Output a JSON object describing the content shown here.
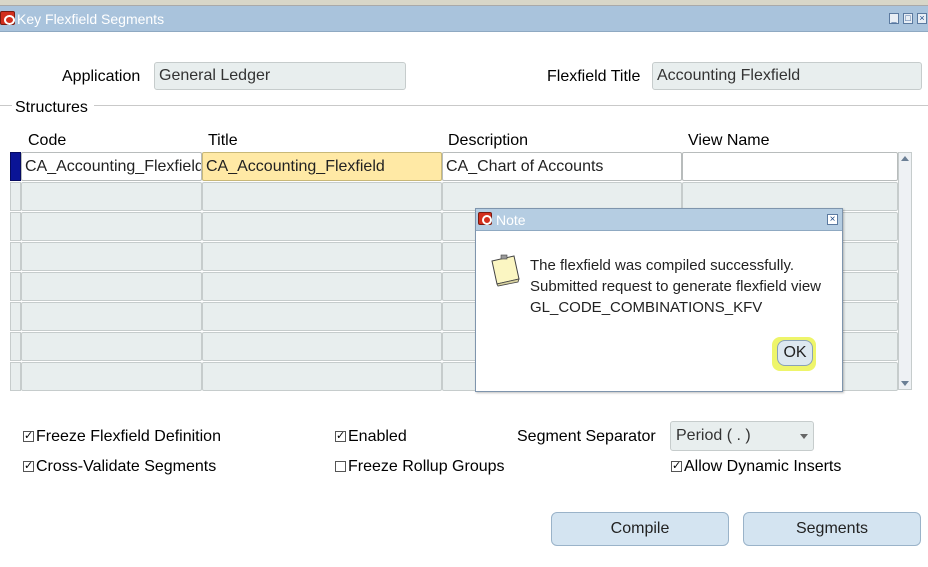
{
  "window": {
    "title": "Key Flexfield Segments"
  },
  "header": {
    "application_label": "Application",
    "application_value": "General Ledger",
    "flexfield_title_label": "Flexfield Title",
    "flexfield_title_value": "Accounting Flexfield"
  },
  "structures": {
    "section_label": "Structures",
    "columns": [
      "Code",
      "Title",
      "Description",
      "View Name"
    ],
    "rows": [
      {
        "code": "CA_Accounting_Flexfield",
        "title": "CA_Accounting_Flexfield",
        "description": "CA_Chart of Accounts",
        "view_name": ""
      }
    ]
  },
  "options": {
    "freeze_definition": {
      "label": "Freeze Flexfield Definition",
      "checked": true
    },
    "cross_validate": {
      "label": "Cross-Validate Segments",
      "checked": true
    },
    "enabled": {
      "label": "Enabled",
      "checked": true
    },
    "freeze_rollup": {
      "label": "Freeze Rollup Groups",
      "checked": false
    },
    "allow_dynamic_inserts": {
      "label": "Allow Dynamic Inserts",
      "checked": true
    },
    "segment_separator_label": "Segment Separator",
    "segment_separator_value": "Period ( . )"
  },
  "buttons": {
    "compile": "Compile",
    "segments": "Segments"
  },
  "note_dialog": {
    "title": "Note",
    "message_line1": "The flexfield was compiled successfully.",
    "message_line2": "Submitted request to generate flexfield view",
    "message_line3": "GL_CODE_COMBINATIONS_KFV",
    "ok_label": "OK"
  },
  "icons": {
    "window_icon": "oracle-o-icon",
    "note_icon": "note-paper-icon"
  },
  "colors": {
    "titlebar": "#a9c3dc",
    "field_bg": "#e8eeee",
    "current_cell": "#ffe9a5",
    "row_indicator": "#0a1496",
    "ok_highlight": "#eef56a"
  }
}
